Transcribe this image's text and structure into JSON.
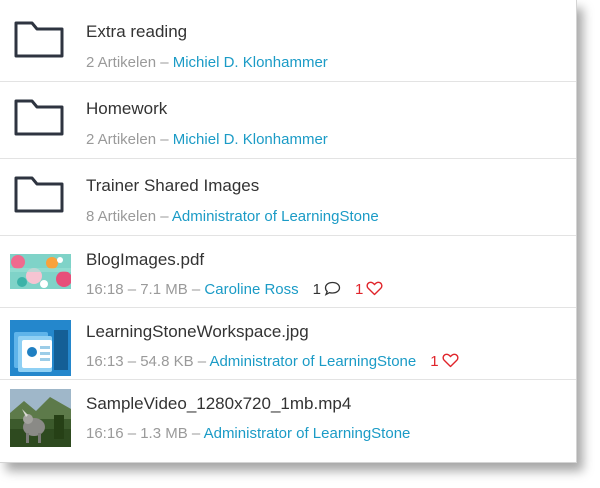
{
  "items": [
    {
      "title": "Extra reading",
      "meta": "2 Artikelen",
      "sep": " – ",
      "author": "Michiel D. Klonhammer",
      "icon": "folder-icon"
    },
    {
      "title": "Homework",
      "meta": "2 Artikelen",
      "sep": " – ",
      "author": "Michiel D. Klonhammer",
      "icon": "folder-icon"
    },
    {
      "title": "Trainer Shared Images",
      "meta": "8 Artikelen",
      "sep": " – ",
      "author": "Administrator of LearningStone",
      "icon": "folder-icon"
    },
    {
      "title": "BlogImages.pdf",
      "meta": "16:18 – 7.1 MB",
      "sep": " – ",
      "author": "Caroline Ross",
      "comments": "1",
      "likes": "1",
      "thumbnail": "colorful-pattern-thumbnail"
    },
    {
      "title": "LearningStoneWorkspace.jpg",
      "meta": "16:13 – 54.8 KB",
      "sep": " – ",
      "author": "Administrator of LearningStone",
      "likes": "1",
      "thumbnail": "workspace-screenshot-thumbnail"
    },
    {
      "title": "SampleVideo_1280x720_1mb.mp4",
      "meta": "16:16 – 1.3 MB",
      "sep": " – ",
      "author": "Administrator of LearningStone",
      "thumbnail": "video-still-thumbnail"
    }
  ],
  "colors": {
    "link": "#1b9bc6",
    "like": "#e0252b",
    "meta": "#9a9a9a",
    "title": "#333333"
  }
}
